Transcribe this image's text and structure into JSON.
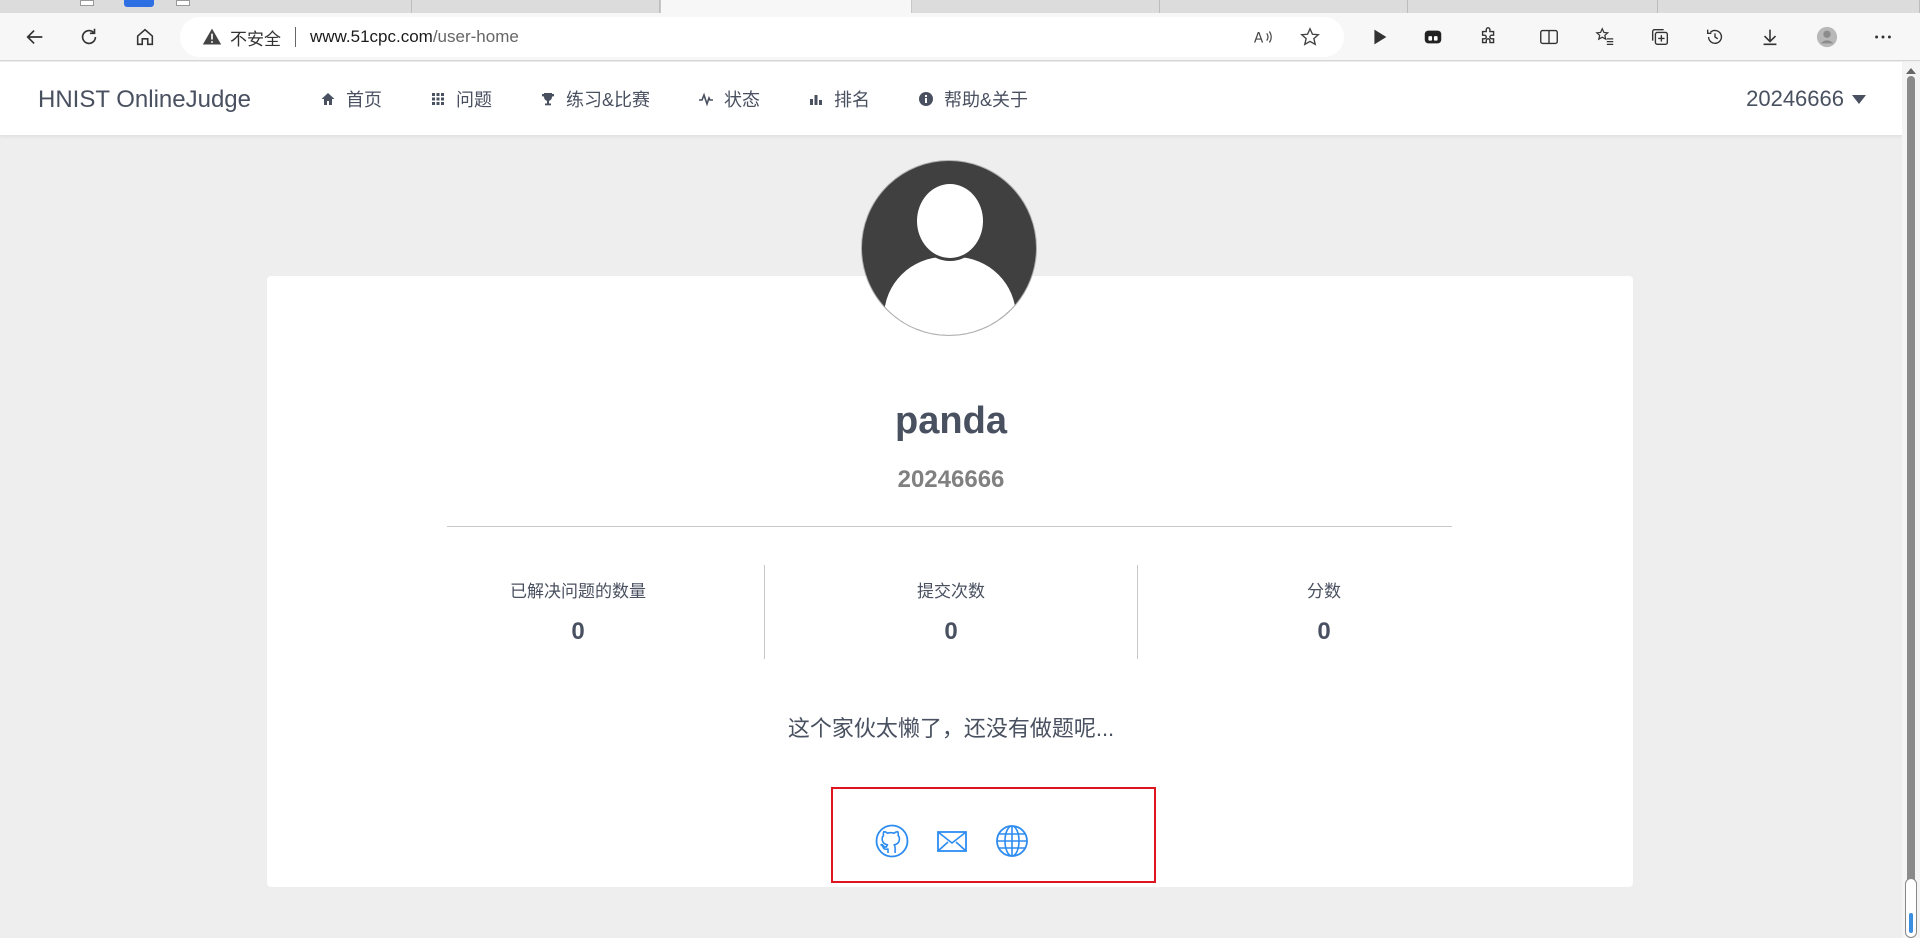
{
  "browser": {
    "insecure_label": "不安全",
    "url_host": "www.51cpc.com",
    "url_path": "/user-home"
  },
  "site": {
    "logo": "HNIST OnlineJudge",
    "nav": [
      {
        "label": "首页",
        "icon": "home-icon"
      },
      {
        "label": "问题",
        "icon": "grid-icon"
      },
      {
        "label": "练习&比赛",
        "icon": "trophy-icon"
      },
      {
        "label": "状态",
        "icon": "pulse-icon"
      },
      {
        "label": "排名",
        "icon": "bar-chart-icon"
      },
      {
        "label": "帮助&关于",
        "icon": "info-icon"
      }
    ],
    "current_user": "20246666"
  },
  "profile": {
    "username": "panda",
    "user_id": "20246666",
    "stats": [
      {
        "label": "已解决问题的数量",
        "value": "0"
      },
      {
        "label": "提交次数",
        "value": "0"
      },
      {
        "label": "分数",
        "value": "0"
      }
    ],
    "empty_message": "这个家伙太懒了，还没有做题呢...",
    "social_icons": [
      "github-icon",
      "mail-icon",
      "globe-icon"
    ],
    "highlight_color": "#e0141e",
    "icon_color": "#2d8cf0"
  }
}
